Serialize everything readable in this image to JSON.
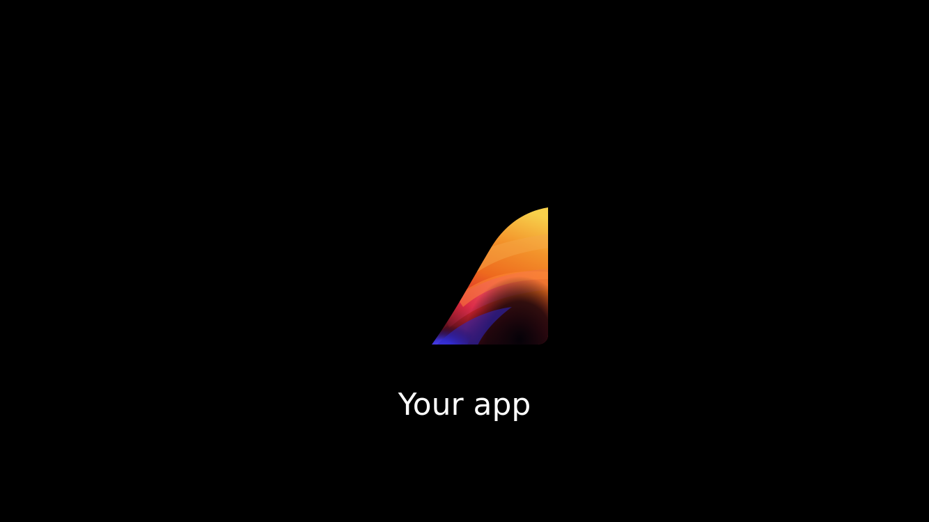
{
  "splash": {
    "app_name": "Your app",
    "logo_icon": "flame-wing-logo-icon"
  },
  "colors": {
    "background": "#000000",
    "text": "#ffffff",
    "logo_yellow": "#f7d04b",
    "logo_orange": "#f2771c",
    "logo_red": "#e0243a",
    "logo_magenta": "#d6336c",
    "logo_blue": "#3a36e6"
  }
}
